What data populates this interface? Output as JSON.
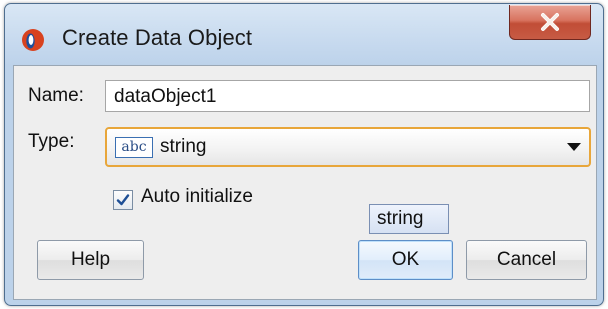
{
  "window": {
    "title": "Create Data Object",
    "close_icon": "close-icon"
  },
  "form": {
    "name_label": "Name:",
    "name_value": "dataObject1",
    "type_label": "Type:",
    "type_icon_text": "abc",
    "type_value": "string",
    "auto_initialize_label": "Auto initialize",
    "auto_initialize_checked": true
  },
  "tooltip": {
    "text": "string"
  },
  "buttons": {
    "help": "Help",
    "ok": "OK",
    "cancel": "Cancel"
  },
  "colors": {
    "close_button": "#c75b44",
    "select_focus": "#e8a63a",
    "default_button": "#5d8ec7"
  }
}
